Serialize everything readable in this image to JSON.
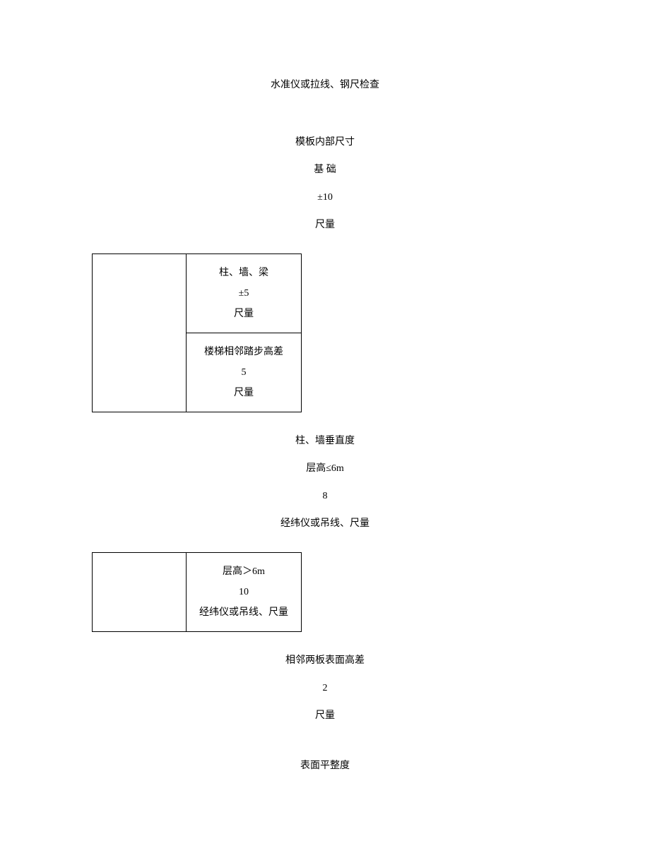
{
  "top": "水准仪或拉线、钢尺检查",
  "sec1": {
    "h": "模板内部尺寸",
    "sub": "基  础",
    "val": "±10",
    "method": "尺量"
  },
  "table1": {
    "r1": {
      "sub": "柱、墙、梁",
      "val": "±5",
      "method": "尺量"
    },
    "r2": {
      "sub": "楼梯相邻踏步高差",
      "val": "5",
      "method": "尺量"
    }
  },
  "sec2": {
    "h": "柱、墙垂直度",
    "sub": "层高≤6m",
    "val": "8",
    "method": "经纬仪或吊线、尺量"
  },
  "table2": {
    "r1": {
      "sub": "层高＞6m",
      "val": "10",
      "method": "经纬仪或吊线、尺量"
    }
  },
  "sec3": {
    "h": "相邻两板表面高差",
    "val": "2",
    "method": "尺量"
  },
  "sec4": {
    "h": "表面平整度"
  }
}
